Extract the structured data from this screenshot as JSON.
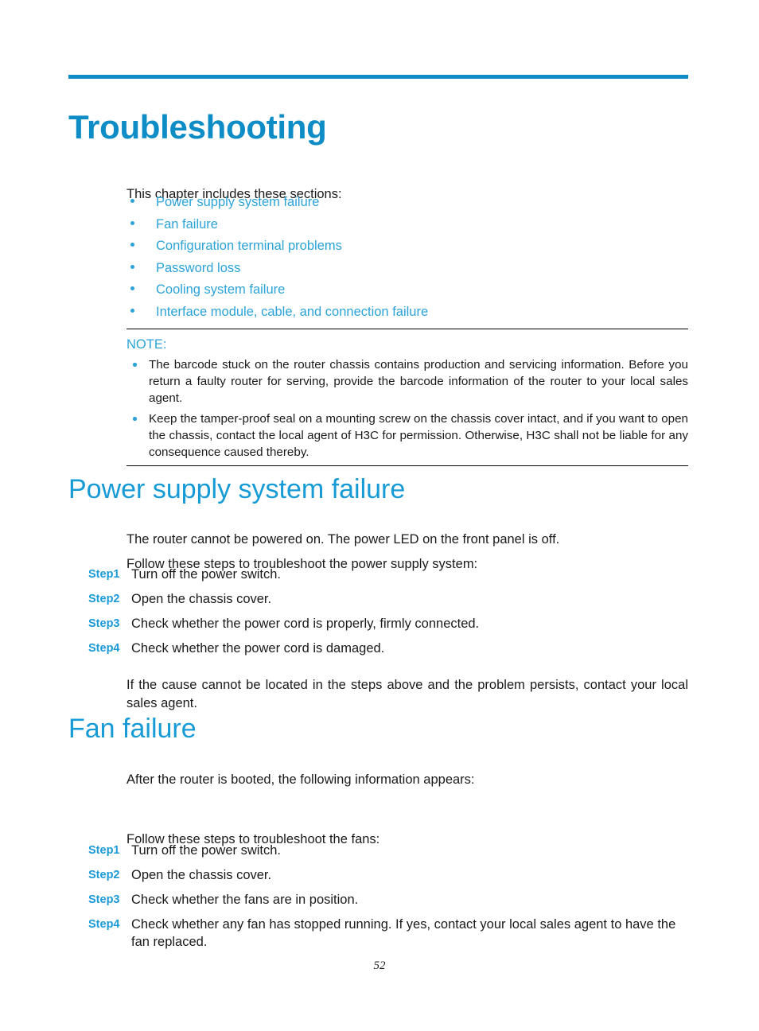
{
  "page": {
    "number": "52",
    "accent_color": "#0d8cc6",
    "link_color": "#2ba3d8",
    "heading_color": "#179bd6",
    "step_label_color": "#1b9ad7"
  },
  "chapter": {
    "title": "Troubleshooting",
    "intro": "This chapter includes these sections:",
    "sections": [
      {
        "label": "Power supply system failure"
      },
      {
        "label": "Fan failure"
      },
      {
        "label": "Configuration terminal problems"
      },
      {
        "label": "Password loss"
      },
      {
        "label": "Cooling system failure"
      },
      {
        "label": "Interface module, cable, and connection failure"
      }
    ]
  },
  "note": {
    "label": "NOTE:",
    "items": [
      "The barcode stuck on the router chassis contains production and servicing information. Before you return a faulty router for serving, provide the barcode information of the router to your local sales agent.",
      "Keep the tamper-proof seal on a mounting screw on the chassis cover intact, and if you want to open the chassis, contact the local agent of H3C for permission. Otherwise, H3C shall not be liable for any consequence caused thereby."
    ]
  },
  "power_section": {
    "heading": "Power supply system failure",
    "symptom": "The router cannot be powered on. The power LED on the front panel is off.",
    "lead_in": "Follow these steps to troubleshoot the power supply system:",
    "steps": [
      {
        "label": "Step1",
        "text": "Turn off the power switch."
      },
      {
        "label": "Step2",
        "text": "Open the chassis cover."
      },
      {
        "label": "Step3",
        "text": "Check whether the power cord is properly, firmly connected."
      },
      {
        "label": "Step4",
        "text": "Check whether the power cord is damaged."
      }
    ],
    "closing": "If the cause cannot be located in the steps above and the problem persists, contact your local sales agent."
  },
  "fan_section": {
    "heading": "Fan failure",
    "symptom": "After the router is booted, the following information appears:",
    "output": "",
    "lead_in": "Follow these steps to troubleshoot the fans:",
    "steps": [
      {
        "label": "Step1",
        "text": "Turn off the power switch."
      },
      {
        "label": "Step2",
        "text": "Open the chassis cover."
      },
      {
        "label": "Step3",
        "text": "Check whether the fans are in position."
      },
      {
        "label": "Step4",
        "text": "Check whether any fan has stopped running. If yes, contact your local sales agent to have the fan replaced."
      }
    ]
  }
}
